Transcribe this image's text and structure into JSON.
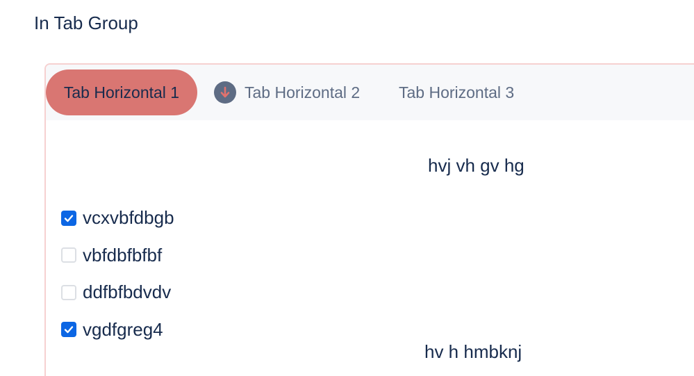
{
  "section": {
    "title": "In Tab Group"
  },
  "tabs": [
    {
      "label": "Tab Horizontal 1",
      "active": true
    },
    {
      "label": "Tab Horizontal 2",
      "icon": "arrow-down-circle-icon"
    },
    {
      "label": "Tab Horizontal 3"
    }
  ],
  "content": {
    "top_text": "hvj vh gv hg",
    "bottom_text": "hv h hmbknj",
    "checklist": [
      {
        "label": "vcxvbfdbgb",
        "checked": true
      },
      {
        "label": "vbfdbfbfbf",
        "checked": false
      },
      {
        "label": "ddfbfbdvdv",
        "checked": false
      },
      {
        "label": "vgdfgreg4",
        "checked": true
      }
    ]
  },
  "colors": {
    "active_tab": "#d97672",
    "checkbox_checked": "#0c66e4",
    "text": "#172b4d",
    "muted_text": "#5e6c84",
    "card_border": "#f6d0d0"
  }
}
